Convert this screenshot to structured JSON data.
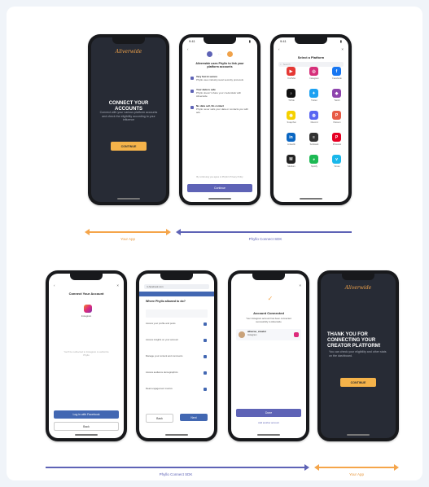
{
  "phone1": {
    "logo": "Aliverwide",
    "title": "CONNECT YOUR ACCOUNTS",
    "body": "Connect with your various platform accounts and check the eligibility according to your influence",
    "cta": "CONTINUE"
  },
  "phone2": {
    "time": "9:41",
    "heading": "Aliverwide uses Phyllo to link your platform accounts",
    "items": [
      {
        "title": "Very fast & secure",
        "text": "Phyllo uses industry-level security protocols"
      },
      {
        "title": "Your data is safe",
        "text": "Phyllo doesn't share your credentials with Aliverwide"
      },
      {
        "title": "No data sell, No contact",
        "text": "Phyllo never sells your data or contacts you with ads"
      }
    ],
    "footer_text": "By continuing you agree to Phyllo's Privacy Policy",
    "button": "Continue"
  },
  "phone3": {
    "time": "9:41",
    "title": "Select a Platform",
    "search_placeholder": "Search",
    "platforms": [
      {
        "name": "YouTube",
        "glyph": "▶",
        "color": "#e53935"
      },
      {
        "name": "Instagram",
        "glyph": "◎",
        "color": "#d6307a"
      },
      {
        "name": "Facebook",
        "glyph": "f",
        "color": "#1877f2"
      },
      {
        "name": "TikTok",
        "glyph": "♪",
        "color": "#111111"
      },
      {
        "name": "Twitter",
        "glyph": "✦",
        "color": "#1da1f2"
      },
      {
        "name": "Twitch",
        "glyph": "◆",
        "color": "#8e44ad"
      },
      {
        "name": "Snapchat",
        "glyph": "◉",
        "color": "#f5d100"
      },
      {
        "name": "Discord",
        "glyph": "◍",
        "color": "#5865f2"
      },
      {
        "name": "Patreon",
        "glyph": "P",
        "color": "#e85b46"
      },
      {
        "name": "LinkedIn",
        "glyph": "in",
        "color": "#0a66c2"
      },
      {
        "name": "Substack",
        "glyph": "≡",
        "color": "#333333"
      },
      {
        "name": "Pinterest",
        "glyph": "P",
        "color": "#e60023"
      },
      {
        "name": "Medium",
        "glyph": "M",
        "color": "#222222"
      },
      {
        "name": "Spotify",
        "glyph": "◕",
        "color": "#1db954"
      },
      {
        "name": "Vimeo",
        "glyph": "v",
        "color": "#1ab7ea"
      }
    ]
  },
  "phone4": {
    "title": "Connect Your Account",
    "platform": "Instagram",
    "note": "You'll be redirected to Instagram to authorize Phyllo",
    "primary": "Log in with Facebook",
    "secondary": "Back"
  },
  "phone5": {
    "url": "m.facebook.com",
    "heading": "Where Phyllo allowed to do?",
    "items": [
      "Access your profile and posts",
      "Access insights on your account",
      "Manage your content and comments",
      "Access audience demographics",
      "Read engagement metrics"
    ],
    "cancel": "Back",
    "next": "Next"
  },
  "phone6": {
    "title": "Account Connected",
    "body": "Your Instagram account has been connected successfully to Aliverwide",
    "account_name": "aliverse_creator",
    "account_sub": "Instagram",
    "primary": "Done",
    "secondary": "Add another account"
  },
  "phone7": {
    "logo": "Aliverwide",
    "title": "THANK YOU FOR CONNECTING YOUR CREATOR PLATFORM!",
    "body": "You can check your eligibility and other stats on the dashboard.",
    "cta": "CONTINUE"
  },
  "flow": {
    "top_left": "Your App",
    "top_right": "Phyllo Connect SDK",
    "bottom_left": "Phyllo Connect SDK",
    "bottom_right": "Your App"
  },
  "colors": {
    "orange": "#f5a54a",
    "purple": "#5e63b6",
    "dark": "#272b35"
  }
}
